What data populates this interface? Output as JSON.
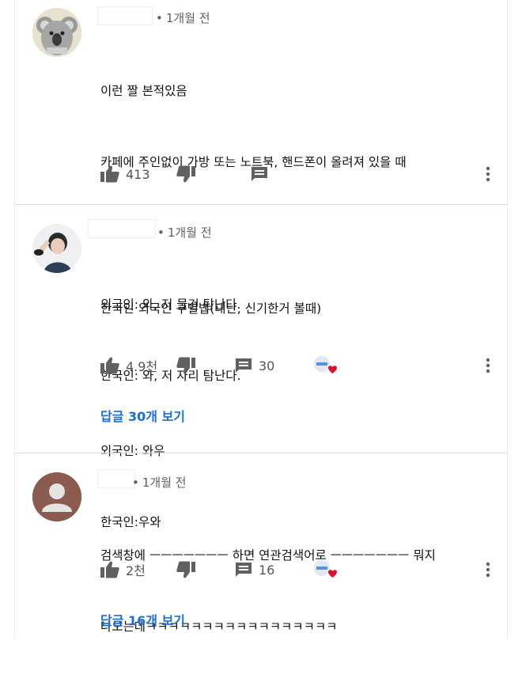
{
  "comments": [
    {
      "time": "1개월 전",
      "lines": [
        "이런 짤 본적있음",
        "카페에 주인없이 가방 또는 노트북, 핸드폰이 올려져 있을 때",
        "",
        "외국인: 와, 저 물건 탐난다.",
        "한국인: 와, 저 자리 탐난다."
      ],
      "likes": "413",
      "replies_count": "",
      "creator_heart": false,
      "view_replies": ""
    },
    {
      "time": "1개월 전",
      "lines": [
        "한국인 외국인 구별법(대단, 신기한거 볼때)",
        "",
        "외국인: 와우",
        "한국인:우와"
      ],
      "likes": "4.9천",
      "replies_count": "30",
      "creator_heart": true,
      "view_replies": "답글 30개 보기"
    },
    {
      "time": "1개월 전",
      "lines": [
        "검색창에 ㅡㅡㅡㅡㅡㅡㅡ 하면 연관검색어로 ㅡㅡㅡㅡㅡㅡㅡ 뭐지",
        "나오는데ㅋㅋㅋㅋㅋㅋㅋㅋㅋㅋㅋㅋㅋㅋㅋㅋㅋ"
      ],
      "likes": "2천",
      "replies_count": "16",
      "creator_heart": true,
      "view_replies": "답글 16개 보기"
    }
  ],
  "dot": "•",
  "colors": {
    "link": "#1a6fd1",
    "heart": "#e0102a",
    "icon": "#606060"
  },
  "icons": {
    "like": "thumb-up-icon",
    "dislike": "thumb-down-icon",
    "reply": "comment-icon",
    "more": "more-vert-icon",
    "heart": "creator-heart-icon"
  }
}
